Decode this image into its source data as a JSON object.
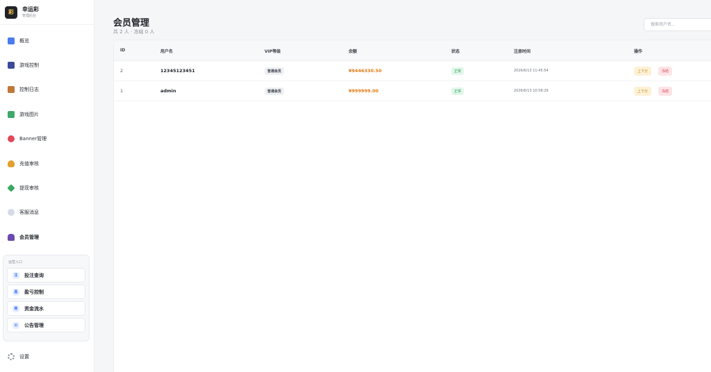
{
  "brand": {
    "logo_char": "彩",
    "name": "幸运彩",
    "sub": "管理后台"
  },
  "nav": [
    {
      "label": "概览",
      "icon": "chart-icon",
      "color": "#4a7cf0"
    },
    {
      "label": "游戏控制",
      "icon": "gamepad-icon",
      "color": "#3b4a9a"
    },
    {
      "label": "控制日志",
      "icon": "clipboard-icon",
      "color": "#c0783a"
    },
    {
      "label": "游戏图片",
      "icon": "image-icon",
      "color": "#3fa86a"
    },
    {
      "label": "Banner管理",
      "icon": "target-icon",
      "color": "#e0485a"
    },
    {
      "label": "充值审核",
      "icon": "money-bag-icon",
      "color": "#e0a030"
    },
    {
      "label": "提现审核",
      "icon": "money-icon",
      "color": "#3aa860"
    },
    {
      "label": "客服消息",
      "icon": "chat-icon",
      "color": "#9aa3b5"
    },
    {
      "label": "会员管理",
      "icon": "users-icon",
      "color": "#6a4ab0"
    }
  ],
  "ops": {
    "title": "运营入口",
    "items": [
      {
        "badge": "注",
        "label": "投注查询"
      },
      {
        "badge": "盈",
        "label": "盈亏控制"
      },
      {
        "badge": "账",
        "label": "资金流水"
      },
      {
        "badge": "公",
        "label": "公告管理"
      }
    ]
  },
  "settings_label": "设置",
  "page": {
    "title": "会员管理",
    "subtitle": "共 2 人 · 冻结 0 人",
    "search_placeholder": "搜索用户名..."
  },
  "table": {
    "headers": [
      "ID",
      "用户名",
      "VIP等级",
      "余额",
      "状态",
      "注册时间",
      "操作"
    ],
    "rows": [
      {
        "id": "2",
        "username": "12345123451",
        "vip": "普通会员",
        "balance": "¥9446330.50",
        "status": "正常",
        "registered": "2026/6/13 11:45:54",
        "adjust": "上下分",
        "freeze": "冻结"
      },
      {
        "id": "1",
        "username": "admin",
        "vip": "普通会员",
        "balance": "¥999999.00",
        "status": "正常",
        "registered": "2026/6/13 10:58:29",
        "adjust": "上下分",
        "freeze": "冻结"
      }
    ]
  },
  "colors": {
    "accent": "#3370ff",
    "balance": "#e07a10",
    "status_ok": "#2aa45a",
    "freeze": "#d9435a"
  }
}
